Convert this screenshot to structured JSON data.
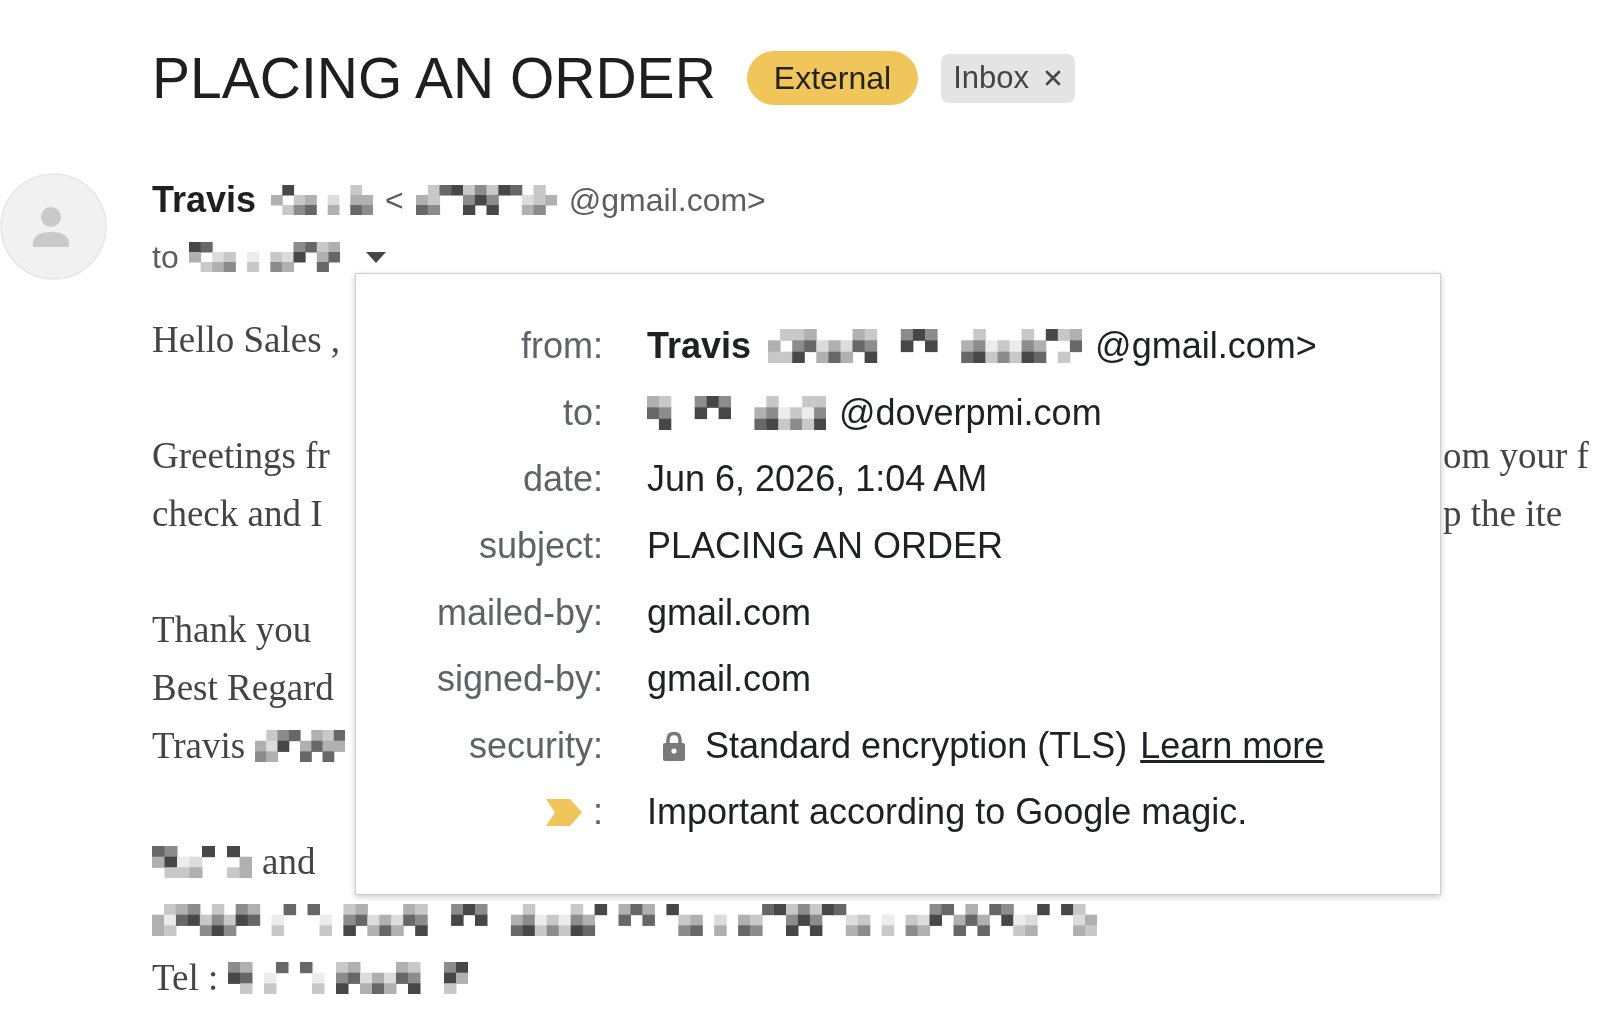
{
  "header": {
    "title": "PLACING AN ORDER",
    "labels": [
      {
        "text": "External",
        "kind": "pill"
      },
      {
        "text": "Inbox",
        "kind": "chip"
      }
    ]
  },
  "sender": {
    "parts": [
      {
        "kind": "name",
        "text": "Travis"
      },
      {
        "kind": "redacted"
      },
      {
        "kind": "text",
        "text": "<"
      },
      {
        "kind": "redacted"
      },
      {
        "kind": "text",
        "text": "@gmail.com>"
      }
    ]
  },
  "recipient": {
    "parts": [
      {
        "kind": "text",
        "text": "to"
      },
      {
        "kind": "redacted"
      }
    ],
    "expanded": true
  },
  "body": {
    "paragraphs": [
      [
        {
          "parts": [
            {
              "kind": "text",
              "text": "Hello Sales ,"
            }
          ]
        }
      ],
      [
        {
          "parts": [
            {
              "kind": "text",
              "text": "Greetings fr"
            }
          ],
          "tail": "om your f"
        },
        {
          "parts": [
            {
              "kind": "text",
              "text": "check and I"
            }
          ],
          "tail": "p the ite"
        }
      ],
      [
        {
          "parts": [
            {
              "kind": "text",
              "text": "Thank you"
            }
          ]
        },
        {
          "parts": [
            {
              "kind": "text",
              "text": "Best Regard"
            }
          ]
        },
        {
          "parts": [
            {
              "kind": "text",
              "text": "Travis"
            },
            {
              "kind": "redacted"
            }
          ]
        }
      ],
      [
        {
          "parts": [
            {
              "kind": "redacted"
            },
            {
              "kind": "text",
              "text": "and"
            }
          ]
        },
        {
          "parts": [
            {
              "kind": "redacted"
            }
          ]
        },
        {
          "parts": [
            {
              "kind": "text",
              "text": "Tel :"
            },
            {
              "kind": "redacted"
            }
          ]
        }
      ]
    ]
  },
  "details": {
    "rows": [
      {
        "label": "from:",
        "kind": "plain",
        "parts": [
          {
            "kind": "name",
            "text": "Travis"
          },
          {
            "kind": "redacted"
          },
          {
            "kind": "text",
            "text": "@gmail.com>"
          }
        ]
      },
      {
        "label": "to:",
        "kind": "plain",
        "parts": [
          {
            "kind": "redacted"
          },
          {
            "kind": "text",
            "text": "@doverpmi.com"
          }
        ]
      },
      {
        "label": "date:",
        "kind": "plain",
        "parts": [
          {
            "kind": "text",
            "text": "Jun 6, 2026, 1:04 AM"
          }
        ]
      },
      {
        "label": "subject:",
        "kind": "plain",
        "parts": [
          {
            "kind": "text",
            "text": "PLACING AN ORDER"
          }
        ]
      },
      {
        "label": "mailed-by:",
        "kind": "plain",
        "parts": [
          {
            "kind": "text",
            "text": "gmail.com"
          }
        ]
      },
      {
        "label": "signed-by:",
        "kind": "plain",
        "parts": [
          {
            "kind": "text",
            "text": "gmail.com"
          }
        ]
      },
      {
        "label": "security:",
        "kind": "security",
        "parts": [
          {
            "kind": "text",
            "text": "Standard encryption (TLS)"
          },
          {
            "kind": "link",
            "text": "Learn more"
          }
        ]
      },
      {
        "label": ":",
        "kind": "importance",
        "parts": [
          {
            "kind": "text",
            "text": "Important according to Google magic."
          }
        ]
      }
    ]
  }
}
